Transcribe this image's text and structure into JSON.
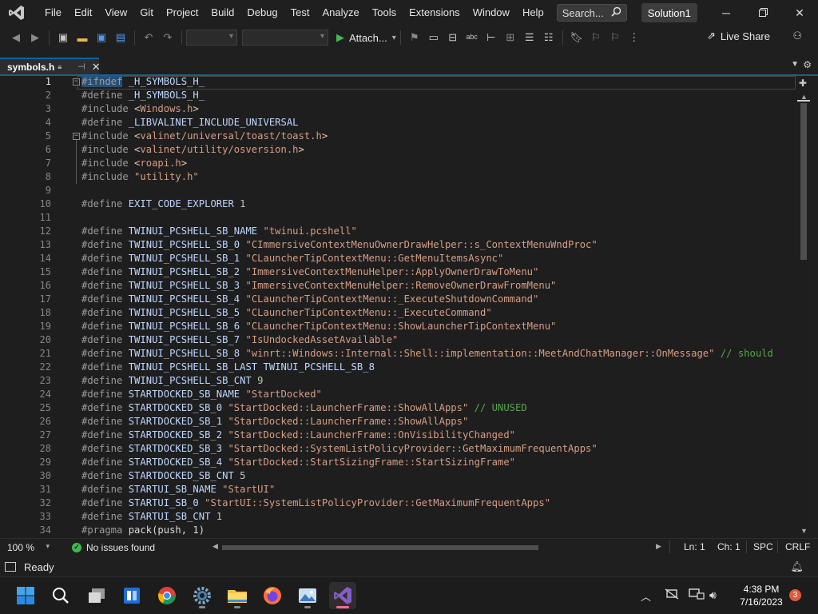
{
  "app": {
    "solution_name": "Solution1"
  },
  "menu": [
    "File",
    "Edit",
    "View",
    "Git",
    "Project",
    "Build",
    "Debug",
    "Test",
    "Analyze",
    "Tools",
    "Extensions",
    "Window",
    "Help"
  ],
  "search": {
    "placeholder": "Search..."
  },
  "toolbar": {
    "attach_label": "Attach...",
    "liveshare_label": "Live Share"
  },
  "tab": {
    "filename": "symbols.h"
  },
  "editor": {
    "current_line": 1,
    "lines": [
      {
        "n": "1",
        "tokens": [
          [
            "kw-sel",
            "#ifndef"
          ],
          [
            "plain",
            " "
          ],
          [
            "mac",
            "_H_SYMBOLS_H_"
          ]
        ]
      },
      {
        "n": "2",
        "tokens": [
          [
            "kw-pp",
            "#define"
          ],
          [
            "plain",
            " "
          ],
          [
            "mac",
            "_H_SYMBOLS_H_"
          ]
        ]
      },
      {
        "n": "3",
        "tokens": [
          [
            "kw-pp",
            "#include"
          ],
          [
            "plain",
            " "
          ],
          [
            "inc",
            "<"
          ],
          [
            "str",
            "Windows.h"
          ],
          [
            "inc",
            ">"
          ]
        ]
      },
      {
        "n": "4",
        "tokens": [
          [
            "kw-pp",
            "#define"
          ],
          [
            "plain",
            " "
          ],
          [
            "mac",
            "_LIBVALINET_INCLUDE_UNIVERSAL"
          ]
        ]
      },
      {
        "n": "5",
        "tokens": [
          [
            "kw-pp",
            "#include"
          ],
          [
            "plain",
            " "
          ],
          [
            "inc",
            "<"
          ],
          [
            "str",
            "valinet/universal/toast/toast.h"
          ],
          [
            "inc",
            ">"
          ]
        ]
      },
      {
        "n": "6",
        "tokens": [
          [
            "kw-pp",
            "#include"
          ],
          [
            "plain",
            " "
          ],
          [
            "inc",
            "<"
          ],
          [
            "str",
            "valinet/utility/osversion.h"
          ],
          [
            "inc",
            ">"
          ]
        ]
      },
      {
        "n": "7",
        "tokens": [
          [
            "kw-pp",
            "#include"
          ],
          [
            "plain",
            " "
          ],
          [
            "inc",
            "<"
          ],
          [
            "str",
            "roapi.h"
          ],
          [
            "inc",
            ">"
          ]
        ]
      },
      {
        "n": "8",
        "tokens": [
          [
            "kw-pp",
            "#include"
          ],
          [
            "plain",
            " "
          ],
          [
            "str",
            "\"utility.h\""
          ]
        ]
      },
      {
        "n": "9",
        "tokens": []
      },
      {
        "n": "10",
        "tokens": [
          [
            "kw-pp",
            "#define"
          ],
          [
            "plain",
            " "
          ],
          [
            "mac",
            "EXIT_CODE_EXPLORER"
          ],
          [
            "plain",
            " "
          ],
          [
            "num",
            "1"
          ]
        ]
      },
      {
        "n": "11",
        "tokens": []
      },
      {
        "n": "12",
        "tokens": [
          [
            "kw-pp",
            "#define"
          ],
          [
            "plain",
            " "
          ],
          [
            "mac",
            "TWINUI_PCSHELL_SB_NAME"
          ],
          [
            "plain",
            " "
          ],
          [
            "str",
            "\"twinui.pcshell\""
          ]
        ]
      },
      {
        "n": "13",
        "tokens": [
          [
            "kw-pp",
            "#define"
          ],
          [
            "plain",
            " "
          ],
          [
            "mac",
            "TWINUI_PCSHELL_SB_0"
          ],
          [
            "plain",
            " "
          ],
          [
            "str",
            "\"CImmersiveContextMenuOwnerDrawHelper::s_ContextMenuWndProc\""
          ]
        ]
      },
      {
        "n": "14",
        "tokens": [
          [
            "kw-pp",
            "#define"
          ],
          [
            "plain",
            " "
          ],
          [
            "mac",
            "TWINUI_PCSHELL_SB_1"
          ],
          [
            "plain",
            " "
          ],
          [
            "str",
            "\"CLauncherTipContextMenu::GetMenuItemsAsync\""
          ]
        ]
      },
      {
        "n": "15",
        "tokens": [
          [
            "kw-pp",
            "#define"
          ],
          [
            "plain",
            " "
          ],
          [
            "mac",
            "TWINUI_PCSHELL_SB_2"
          ],
          [
            "plain",
            " "
          ],
          [
            "str",
            "\"ImmersiveContextMenuHelper::ApplyOwnerDrawToMenu\""
          ]
        ]
      },
      {
        "n": "16",
        "tokens": [
          [
            "kw-pp",
            "#define"
          ],
          [
            "plain",
            " "
          ],
          [
            "mac",
            "TWINUI_PCSHELL_SB_3"
          ],
          [
            "plain",
            " "
          ],
          [
            "str",
            "\"ImmersiveContextMenuHelper::RemoveOwnerDrawFromMenu\""
          ]
        ]
      },
      {
        "n": "17",
        "tokens": [
          [
            "kw-pp",
            "#define"
          ],
          [
            "plain",
            " "
          ],
          [
            "mac",
            "TWINUI_PCSHELL_SB_4"
          ],
          [
            "plain",
            " "
          ],
          [
            "str",
            "\"CLauncherTipContextMenu::_ExecuteShutdownCommand\""
          ]
        ]
      },
      {
        "n": "18",
        "tokens": [
          [
            "kw-pp",
            "#define"
          ],
          [
            "plain",
            " "
          ],
          [
            "mac",
            "TWINUI_PCSHELL_SB_5"
          ],
          [
            "plain",
            " "
          ],
          [
            "str",
            "\"CLauncherTipContextMenu::_ExecuteCommand\""
          ]
        ]
      },
      {
        "n": "19",
        "tokens": [
          [
            "kw-pp",
            "#define"
          ],
          [
            "plain",
            " "
          ],
          [
            "mac",
            "TWINUI_PCSHELL_SB_6"
          ],
          [
            "plain",
            " "
          ],
          [
            "str",
            "\"CLauncherTipContextMenu::ShowLauncherTipContextMenu\""
          ]
        ]
      },
      {
        "n": "20",
        "tokens": [
          [
            "kw-pp",
            "#define"
          ],
          [
            "plain",
            " "
          ],
          [
            "mac",
            "TWINUI_PCSHELL_SB_7"
          ],
          [
            "plain",
            " "
          ],
          [
            "str",
            "\"IsUndockedAssetAvailable\""
          ]
        ]
      },
      {
        "n": "21",
        "tokens": [
          [
            "kw-pp",
            "#define"
          ],
          [
            "plain",
            " "
          ],
          [
            "mac",
            "TWINUI_PCSHELL_SB_8"
          ],
          [
            "plain",
            " "
          ],
          [
            "str",
            "\"winrt::Windows::Internal::Shell::implementation::MeetAndChatManager::OnMessage\""
          ],
          [
            "plain",
            " "
          ],
          [
            "cmt",
            "// should"
          ]
        ]
      },
      {
        "n": "22",
        "tokens": [
          [
            "kw-pp",
            "#define"
          ],
          [
            "plain",
            " "
          ],
          [
            "mac",
            "TWINUI_PCSHELL_SB_LAST"
          ],
          [
            "plain",
            " "
          ],
          [
            "mac",
            "TWINUI_PCSHELL_SB_8"
          ]
        ]
      },
      {
        "n": "23",
        "tokens": [
          [
            "kw-pp",
            "#define"
          ],
          [
            "plain",
            " "
          ],
          [
            "mac",
            "TWINUI_PCSHELL_SB_CNT"
          ],
          [
            "plain",
            " "
          ],
          [
            "num",
            "9"
          ]
        ]
      },
      {
        "n": "24",
        "tokens": [
          [
            "kw-pp",
            "#define"
          ],
          [
            "plain",
            " "
          ],
          [
            "mac",
            "STARTDOCKED_SB_NAME"
          ],
          [
            "plain",
            " "
          ],
          [
            "str",
            "\"StartDocked\""
          ]
        ]
      },
      {
        "n": "25",
        "tokens": [
          [
            "kw-pp",
            "#define"
          ],
          [
            "plain",
            " "
          ],
          [
            "mac",
            "STARTDOCKED_SB_0"
          ],
          [
            "plain",
            " "
          ],
          [
            "str",
            "\"StartDocked::LauncherFrame::ShowAllApps\""
          ],
          [
            "plain",
            " "
          ],
          [
            "cmt",
            "// UNUSED"
          ]
        ]
      },
      {
        "n": "26",
        "tokens": [
          [
            "kw-pp",
            "#define"
          ],
          [
            "plain",
            " "
          ],
          [
            "mac",
            "STARTDOCKED_SB_1"
          ],
          [
            "plain",
            " "
          ],
          [
            "str",
            "\"StartDocked::LauncherFrame::ShowAllApps\""
          ]
        ]
      },
      {
        "n": "27",
        "tokens": [
          [
            "kw-pp",
            "#define"
          ],
          [
            "plain",
            " "
          ],
          [
            "mac",
            "STARTDOCKED_SB_2"
          ],
          [
            "plain",
            " "
          ],
          [
            "str",
            "\"StartDocked::LauncherFrame::OnVisibilityChanged\""
          ]
        ]
      },
      {
        "n": "28",
        "tokens": [
          [
            "kw-pp",
            "#define"
          ],
          [
            "plain",
            " "
          ],
          [
            "mac",
            "STARTDOCKED_SB_3"
          ],
          [
            "plain",
            " "
          ],
          [
            "str",
            "\"StartDocked::SystemListPolicyProvider::GetMaximumFrequentApps\""
          ]
        ]
      },
      {
        "n": "29",
        "tokens": [
          [
            "kw-pp",
            "#define"
          ],
          [
            "plain",
            " "
          ],
          [
            "mac",
            "STARTDOCKED_SB_4"
          ],
          [
            "plain",
            " "
          ],
          [
            "str",
            "\"StartDocked::StartSizingFrame::StartSizingFrame\""
          ]
        ]
      },
      {
        "n": "30",
        "tokens": [
          [
            "kw-pp",
            "#define"
          ],
          [
            "plain",
            " "
          ],
          [
            "mac",
            "STARTDOCKED_SB_CNT"
          ],
          [
            "plain",
            " "
          ],
          [
            "num",
            "5"
          ]
        ]
      },
      {
        "n": "31",
        "tokens": [
          [
            "kw-pp",
            "#define"
          ],
          [
            "plain",
            " "
          ],
          [
            "mac",
            "STARTUI_SB_NAME"
          ],
          [
            "plain",
            " "
          ],
          [
            "str",
            "\"StartUI\""
          ]
        ]
      },
      {
        "n": "32",
        "tokens": [
          [
            "kw-pp",
            "#define"
          ],
          [
            "plain",
            " "
          ],
          [
            "mac",
            "STARTUI_SB_0"
          ],
          [
            "plain",
            " "
          ],
          [
            "str",
            "\"StartUI::SystemListPolicyProvider::GetMaximumFrequentApps\""
          ]
        ]
      },
      {
        "n": "33",
        "tokens": [
          [
            "kw-pp",
            "#define"
          ],
          [
            "plain",
            " "
          ],
          [
            "mac",
            "STARTUI_SB_CNT"
          ],
          [
            "plain",
            " "
          ],
          [
            "num",
            "1"
          ]
        ]
      },
      {
        "n": "34",
        "tokens": [
          [
            "kw-pp",
            "#pragma"
          ],
          [
            "plain",
            " "
          ],
          [
            "plain",
            "pack(push, 1)"
          ]
        ]
      }
    ]
  },
  "status": {
    "zoom": "100 %",
    "issues": "No issues found",
    "ln": "Ln: 1",
    "ch": "Ch: 1",
    "spc": "SPC",
    "crlf": "CRLF",
    "ready": "Ready"
  },
  "taskbar": {
    "apps": [
      "start",
      "search",
      "task-view",
      "office",
      "chrome",
      "settings",
      "file-explorer",
      "firefox",
      "photos",
      "visual-studio"
    ],
    "time": "4:38 PM",
    "date": "7/16/2023",
    "notifications": "3"
  },
  "colors": {
    "accent": "#0e639c",
    "string": "#d69d85",
    "comment": "#57a64a",
    "number": "#b5cea8",
    "macro": "#bed6ff",
    "preprocessor": "#9b9b9b",
    "vs_purple": "#865fc5"
  }
}
